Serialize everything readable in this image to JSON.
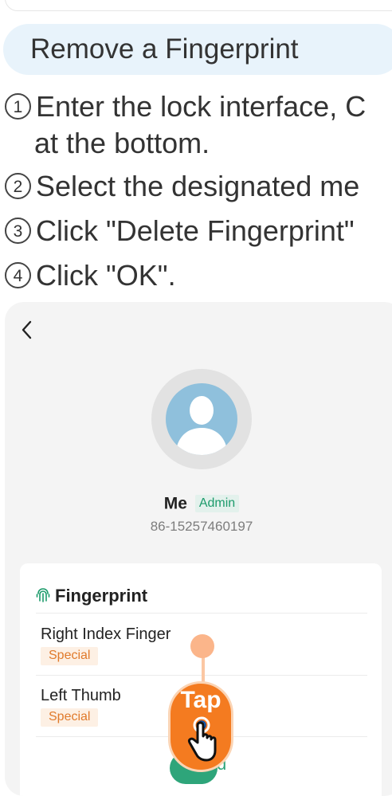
{
  "section": {
    "title": "Remove a Fingerprint"
  },
  "steps": [
    {
      "num": "1",
      "text": "Enter the lock interface, C",
      "continuation": "at the bottom."
    },
    {
      "num": "2",
      "text": "Select the designated me"
    },
    {
      "num": "3",
      "text": "Click \"Delete Fingerprint\""
    },
    {
      "num": "4",
      "text": "Click \"OK\"."
    }
  ],
  "profile": {
    "name": "Me",
    "role_badge": "Admin",
    "phone": "86-15257460197"
  },
  "fingerprint": {
    "title": "Fingerprint",
    "items": [
      {
        "name": "Right Index Finger",
        "tag": "Special"
      },
      {
        "name": "Left Thumb",
        "tag": "Special"
      }
    ],
    "add_button_fragment": "d"
  },
  "tap_indicator": {
    "label": "Tap"
  },
  "colors": {
    "header_bg": "#e8f3fb",
    "admin_green": "#1c9b6b",
    "special_orange": "#e07a2b",
    "tap_orange": "#f47b20",
    "avatar_blue": "#8fc0dc"
  },
  "icons": {
    "back": "chevron-left-icon",
    "fingerprint": "fingerprint-icon",
    "hand": "hand-pointer-icon"
  }
}
